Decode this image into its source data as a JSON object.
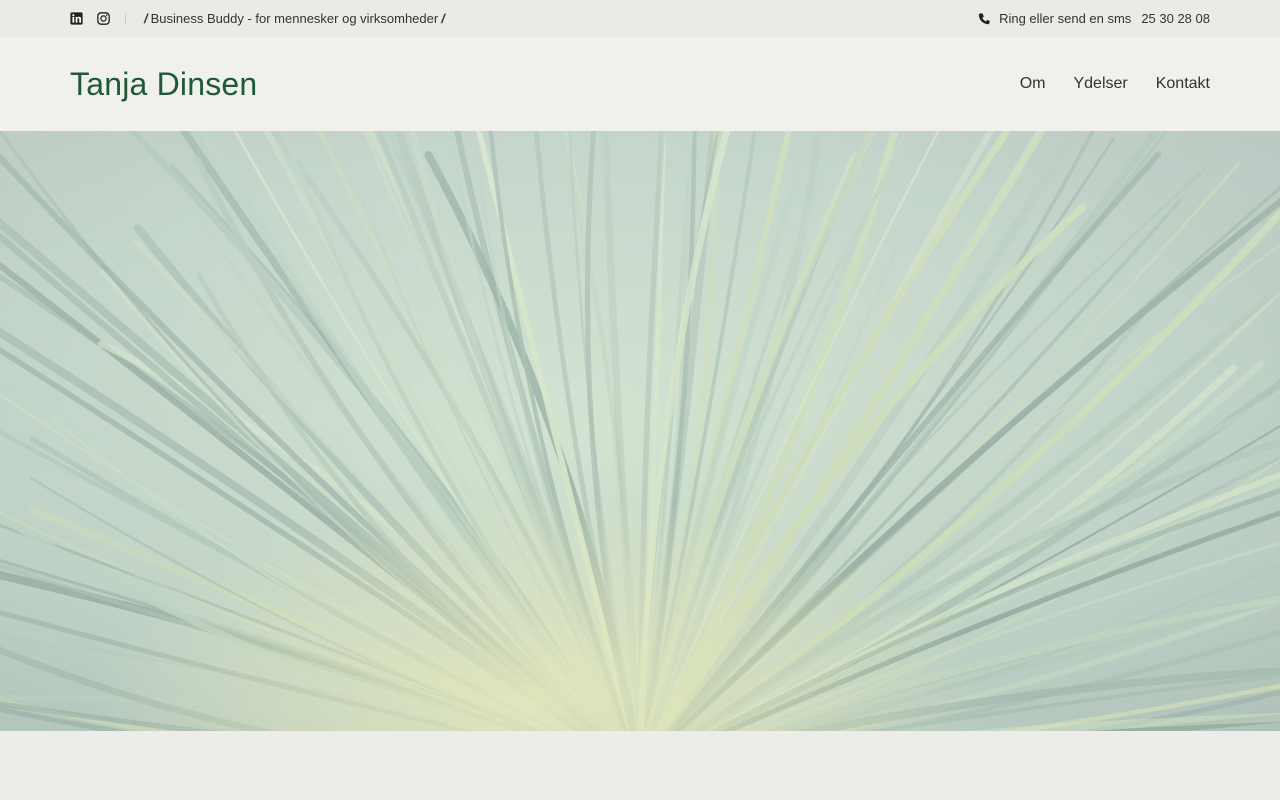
{
  "topbar": {
    "social_icons": [
      "linkedin-icon",
      "instagram-icon"
    ],
    "tagline": "Business Buddy - for mennesker og virksomheder",
    "slash": "/",
    "phone_icon": "phone-icon",
    "phone_label": "Ring eller send en sms",
    "phone_number": "25 30 28 08"
  },
  "header": {
    "logo": "Tanja Dinsen",
    "nav": [
      "Om",
      "Ydelser",
      "Kontakt"
    ]
  },
  "colors": {
    "brand": "#1e5a35",
    "topbar_bg": "#e9ebe7",
    "header_bg": "#f0f0ed",
    "page_bg": "#ecece8"
  }
}
